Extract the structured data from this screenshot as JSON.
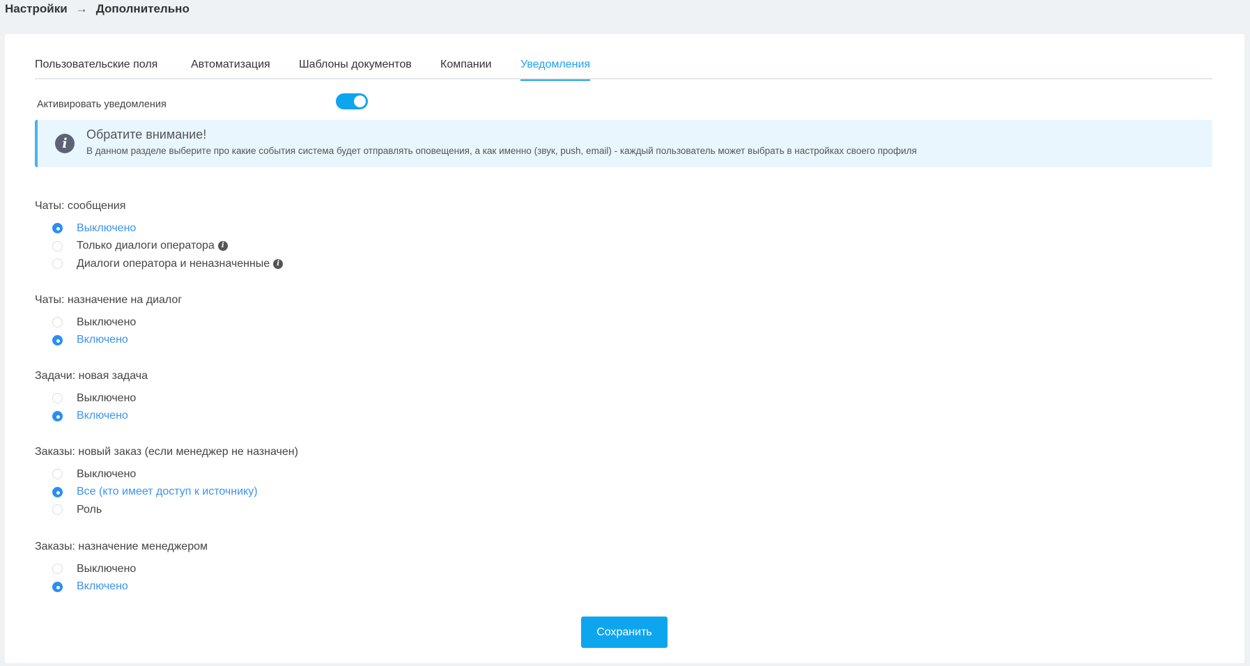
{
  "breadcrumb": {
    "root": "Настройки",
    "arrow": "→",
    "current": "Дополнительно"
  },
  "tabs": [
    {
      "label": "Пользовательские поля"
    },
    {
      "label": "Автоматизация"
    },
    {
      "label": "Шаблоны документов"
    },
    {
      "label": "Компании"
    },
    {
      "label": "Уведомления",
      "active": true
    }
  ],
  "toggle": {
    "label": "Активировать уведомления",
    "on": true
  },
  "alert": {
    "title": "Обратите внимание!",
    "text": "В данном разделе выберите про какие события система будет отправлять оповещения, а как именно (звук, push, email) - каждый пользователь может выбрать в настройках своего профиля",
    "icon": "i"
  },
  "sections": [
    {
      "title": "Чаты: сообщения",
      "options": [
        "Выключено",
        "Только диалоги оператора",
        "Диалоги оператора и неназначенные"
      ],
      "selected": 0
    },
    {
      "title": "Чаты: назначение на диалог",
      "options": [
        "Выключено",
        "Включено"
      ],
      "selected": 1
    },
    {
      "title": "Задачи: новая задача",
      "options": [
        "Выключено",
        "Включено"
      ],
      "selected": 1
    },
    {
      "title": "Заказы: новый заказ (если менеджер не назначен)",
      "options": [
        "Выключено",
        "Все (кто имеет доступ к источнику)",
        "Роль"
      ],
      "selected": 1
    },
    {
      "title": "Заказы: назначение менеджером",
      "options": [
        "Выключено",
        "Включено"
      ],
      "selected": 1
    }
  ],
  "info_glyph": "i",
  "save_label": "Сохранить",
  "colors": {
    "accent": "#0ea5ef",
    "selected": "#2b8ef3"
  }
}
